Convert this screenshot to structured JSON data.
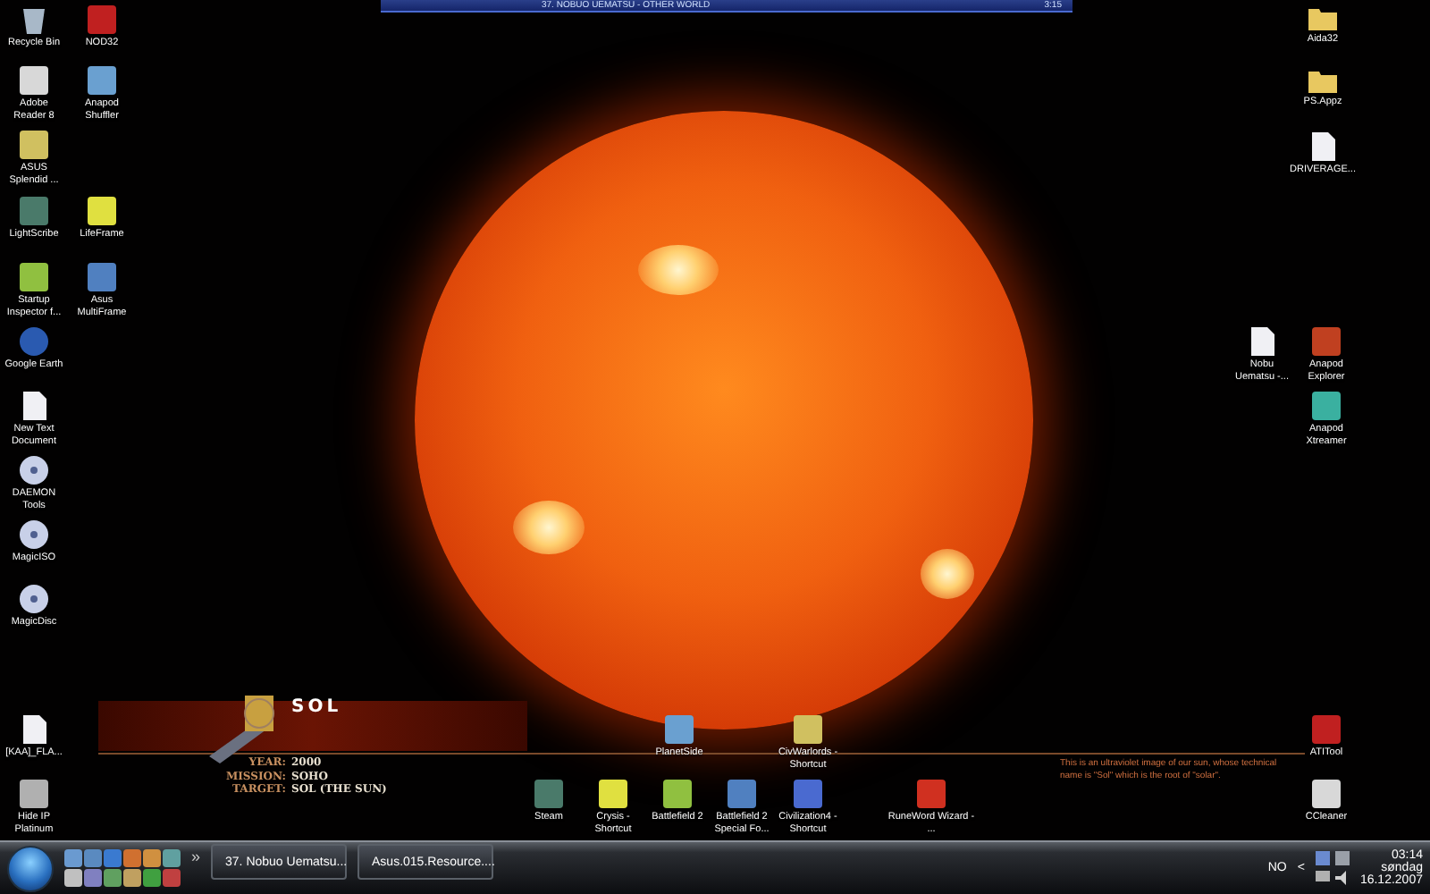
{
  "media_bar": {
    "track": "37. NOBUO UEMATSU - OTHER WORLD",
    "time": "3:15"
  },
  "wallpaper": {
    "title": "SOL",
    "facts": [
      {
        "label": "YEAR:",
        "value": "2000"
      },
      {
        "label": "MISSION:",
        "value": "SOHO"
      },
      {
        "label": "TARGET:",
        "value": "SOL (THE SUN)"
      }
    ],
    "caption": "This is an ultraviolet image of our sun, whose technical name is \"Sol\" which is the root of \"solar\"."
  },
  "desktop_icons": [
    {
      "label": "Recycle Bin",
      "kind": "bin"
    },
    {
      "label": "NOD32",
      "kind": "app"
    },
    {
      "label": "Adobe Reader 8",
      "kind": "app"
    },
    {
      "label": "Anapod Shuffler",
      "kind": "app"
    },
    {
      "label": "ASUS Splendid ...",
      "kind": "app"
    },
    {
      "label": "LightScribe",
      "kind": "app"
    },
    {
      "label": "LifeFrame",
      "kind": "app"
    },
    {
      "label": "Startup Inspector f...",
      "kind": "app"
    },
    {
      "label": "Asus MultiFrame",
      "kind": "app"
    },
    {
      "label": "Google Earth",
      "kind": "globe"
    },
    {
      "label": "New Text Document",
      "kind": "file"
    },
    {
      "label": "DAEMON Tools",
      "kind": "disc"
    },
    {
      "label": "MagicISO",
      "kind": "disc"
    },
    {
      "label": "MagicDisc",
      "kind": "disc"
    },
    {
      "label": "[KAA]_FLA...",
      "kind": "file"
    },
    {
      "label": "Hide IP Platinum",
      "kind": "app"
    },
    {
      "label": "Aida32",
      "kind": "folder"
    },
    {
      "label": "PS.Appz",
      "kind": "folder"
    },
    {
      "label": "DRIVERAGE...",
      "kind": "file"
    },
    {
      "label": "Nobu Uematsu -...",
      "kind": "file"
    },
    {
      "label": "Anapod Explorer",
      "kind": "app"
    },
    {
      "label": "Anapod Xtreamer",
      "kind": "app"
    },
    {
      "label": "ATITool",
      "kind": "app"
    },
    {
      "label": "CCleaner",
      "kind": "app"
    },
    {
      "label": "PlanetSide",
      "kind": "app"
    },
    {
      "label": "CivWarlords - Shortcut",
      "kind": "app"
    },
    {
      "label": "Steam",
      "kind": "app"
    },
    {
      "label": "Crysis - Shortcut",
      "kind": "app"
    },
    {
      "label": "Battlefield 2",
      "kind": "app"
    },
    {
      "label": "Battlefield 2 Special Fo...",
      "kind": "app"
    },
    {
      "label": "Civilization4 - Shortcut",
      "kind": "app"
    },
    {
      "label": "RuneWord Wizard - ...",
      "kind": "app"
    }
  ],
  "taskbar": {
    "overflow": "»",
    "tasks": [
      {
        "label": "37. Nobuo Uematsu...",
        "selected": false
      },
      {
        "label": "Asus.015.Resource....",
        "selected": false
      }
    ],
    "tray": {
      "language": "NO",
      "time": "03:14",
      "day": "søndag",
      "date": "16.12.2007",
      "expand": "<"
    }
  }
}
